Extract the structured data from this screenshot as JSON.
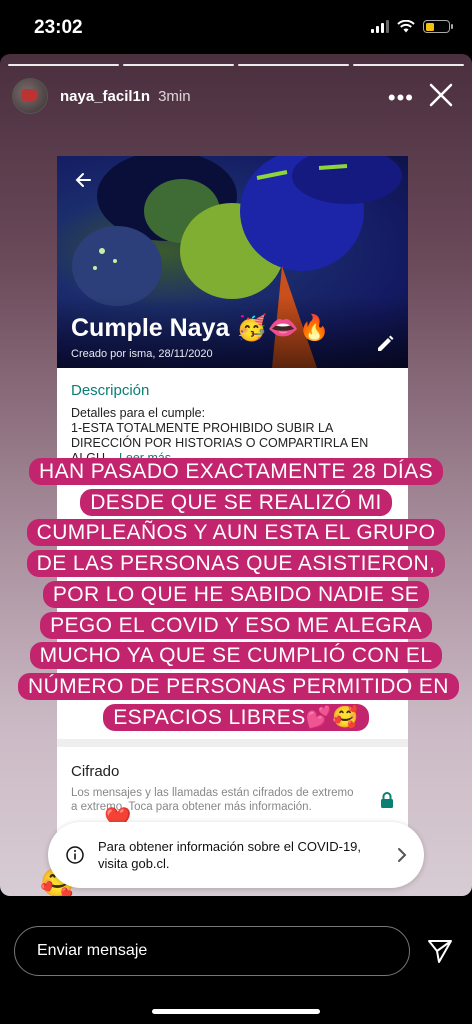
{
  "status_bar": {
    "time": "23:02",
    "battery_color": "#f4c20d"
  },
  "story": {
    "username": "naya_facil1n",
    "time_ago": "3min",
    "text": "HAN PASADO EXACTAMENTE 28 DÍAS DESDE QUE SE REALIZÓ MI CUMPLEAÑOS Y AUN ESTA EL GRUPO DE LAS PERSONAS QUE ASISTIERON, POR LO QUE HE SABIDO NADIE SE PEGO EL COVID Y ESO ME ALEGRA MUCHO YA QUE SE CUMPLIÓ CON EL NÚMERO DE PERSONAS PERMITIDO EN ESPACIOS LIBRES💕🥰",
    "highlight_color": "#c2246e"
  },
  "whatsapp_group": {
    "name": "Cumple Naya 🥳👄🔥",
    "created": "Creado por isma, 28/11/2020",
    "description_title": "Descripción",
    "description": "Detalles para el cumple:\n1-ESTA TOTALMENTE PROHIBIDO SUBIR LA DIRECCIÓN POR HISTORIAS O COMPARTIRLA EN ALGU...",
    "read_more": "Leer más",
    "cipher_title": "Cifrado",
    "cipher_text": "Los mensajes y las llamadas están cifrados de extremo a extremo. Toca para obtener más información.",
    "accent_color": "#0a7f72"
  },
  "covid_sticker": {
    "text": "Para obtener información sobre el COVID-19, visita gob.cl."
  },
  "reply": {
    "placeholder": "Enviar mensaje"
  }
}
